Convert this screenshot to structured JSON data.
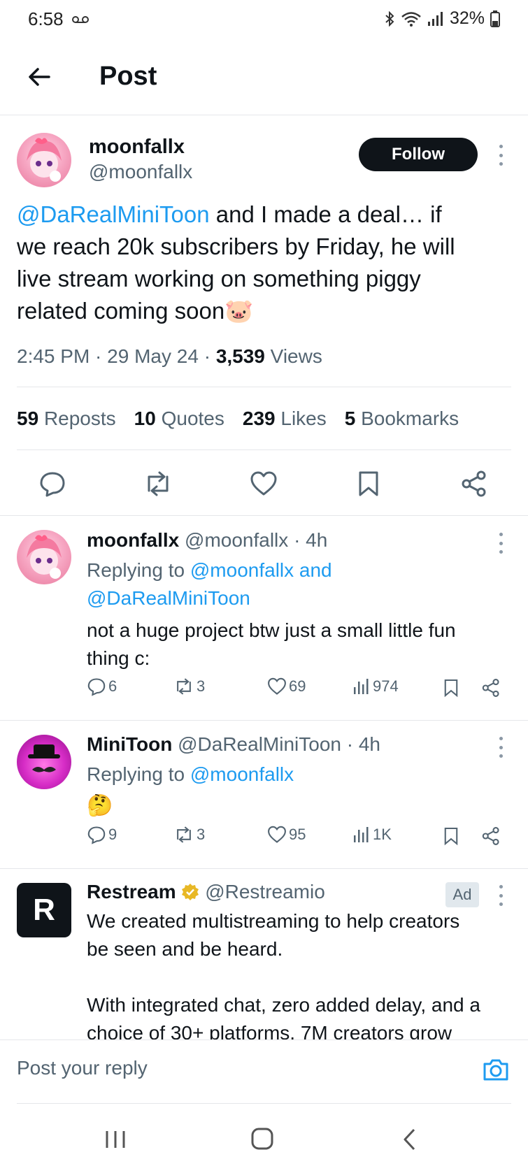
{
  "status_bar": {
    "time": "6:58",
    "battery": "32%",
    "icons": [
      "voicemail-icon",
      "bluetooth-icon",
      "wifi-icon",
      "signal-icon",
      "battery-icon"
    ]
  },
  "header": {
    "title": "Post",
    "back_icon": "arrow-left-icon"
  },
  "post": {
    "author_name": "moonfallx",
    "author_handle": "@moonfallx",
    "follow_label": "Follow",
    "mention": "@DaRealMiniToon",
    "text_line1": " and I made a deal… if",
    "text_line2": "we reach 20k subscribers by Friday, he will",
    "text_line3": "live stream working on something piggy",
    "text_line4": "related coming soon",
    "emoji": "🐷",
    "time": "2:45 PM",
    "date": "29 May 24",
    "views_count": "3,539",
    "views_label": " Views",
    "separator": " · ",
    "stats": {
      "reposts_count": "59",
      "reposts_label": "Reposts",
      "quotes_count": "10",
      "quotes_label": "Quotes",
      "likes_count": "239",
      "likes_label": "Likes",
      "bookmarks_count": "5",
      "bookmarks_label": "Bookmarks"
    }
  },
  "replies": [
    {
      "name": "moonfallx",
      "handle": "@moonfallx",
      "time": "· 4h",
      "replying_prefix": "Replying to ",
      "replying_to_1": "@moonfallx and",
      "replying_to_2": "@DaRealMiniToon",
      "body_line1": "not a huge project btw just a small little fun",
      "body_line2": "thing c:",
      "replies": "6",
      "reposts": "3",
      "likes": "69",
      "views": "974"
    },
    {
      "name": "MiniToon",
      "handle": "@DaRealMiniToon",
      "time": "· 4h",
      "replying_prefix": "Replying to ",
      "replying_to_1": "@moonfallx",
      "body_emoji": "🤔",
      "replies": "9",
      "reposts": "3",
      "likes": "95",
      "views": "1K"
    }
  ],
  "ad": {
    "name": "Restream",
    "handle": "@Restreamio",
    "badge": "Ad",
    "avatar_letter": "R",
    "body_line1": "We created multistreaming to help creators",
    "body_line2": "be seen and be heard.",
    "body_line3": "With integrated chat, zero added delay, and a",
    "body_line4": "choice of 30+ platforms, 7M creators grow"
  },
  "reply_bar": {
    "placeholder": "Post your reply"
  },
  "colors": {
    "link": "#1d9bf0",
    "text": "#0f1419",
    "muted": "#536471",
    "verified": "#e8b825"
  }
}
